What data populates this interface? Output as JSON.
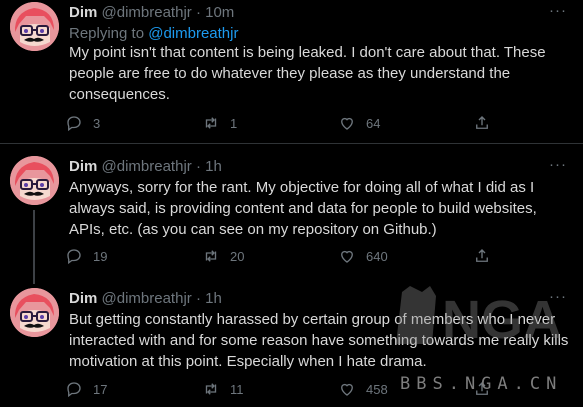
{
  "tweets": [
    {
      "name": "Dim",
      "handle": "@dimbreathjr",
      "dot": "·",
      "time": "10m",
      "replying_to": "Replying to",
      "reply_handle": "@dimbreathjr",
      "text": "My point isn't that content is being leaked. I don't care about that. These people are free to do whatever they please as they understand the consequences.",
      "replies": "3",
      "retweets": "1",
      "likes": "64"
    },
    {
      "name": "Dim",
      "handle": "@dimbreathjr",
      "dot": "·",
      "time": "1h",
      "text": "Anyways, sorry for the rant. My objective for doing all of what I did as I always said, is providing content and data for people to build websites, APIs, etc. (as you can see on my repository on Github.)",
      "replies": "19",
      "retweets": "20",
      "likes": "640"
    },
    {
      "name": "Dim",
      "handle": "@dimbreathjr",
      "dot": "·",
      "time": "1h",
      "text": "But getting constantly harassed by certain group of members who I never interacted with and for some reason have something towards me really kills motivation at this point. Especially when I hate drama.",
      "replies": "17",
      "retweets": "11",
      "likes": "458"
    }
  ],
  "more_glyph": "···",
  "watermark": {
    "logo_text": "NGA",
    "url_text": "BBS.NGA.CN"
  },
  "colors": {
    "background": "#000000",
    "text": "#d9d9d9",
    "muted": "#6e767d",
    "link": "#1d9bf0",
    "divider": "#2f3336"
  },
  "icons": [
    "reply-icon",
    "retweet-icon",
    "like-icon",
    "share-icon",
    "more-icon"
  ]
}
